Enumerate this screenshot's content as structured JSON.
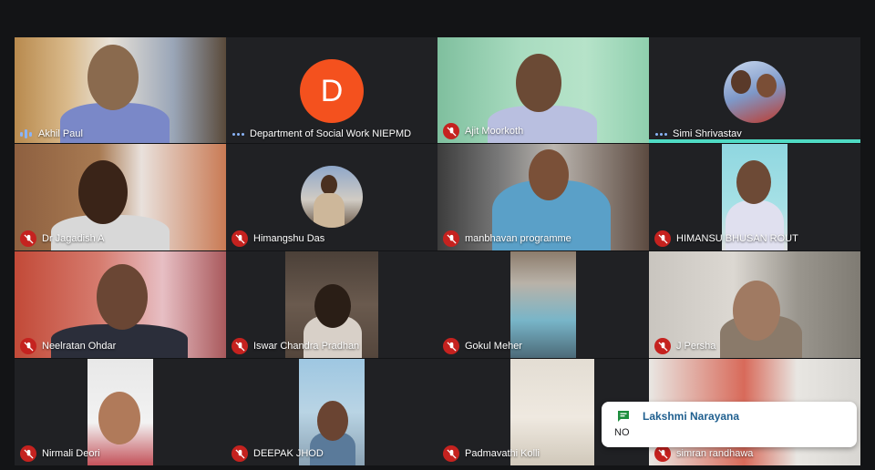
{
  "participants": [
    {
      "name": "Akhil Paul",
      "status": "speaking"
    },
    {
      "name": "Department of Social Work NIEPMD",
      "status": "no-video",
      "avatar_letter": "D",
      "avatar_color": "#f4511e"
    },
    {
      "name": "Ajit Moorkoth",
      "status": "muted"
    },
    {
      "name": "Simi Shrivastav",
      "status": "no-video-active"
    },
    {
      "name": "Dr Jagadish A",
      "status": "muted"
    },
    {
      "name": "Himangshu Das",
      "status": "muted"
    },
    {
      "name": "manbhavan programme",
      "status": "muted"
    },
    {
      "name": "HIMANSU BHUSAN ROUT",
      "status": "muted"
    },
    {
      "name": "Neelratan Ohdar",
      "status": "muted"
    },
    {
      "name": "Iswar Chandra Pradhan",
      "status": "muted"
    },
    {
      "name": "Gokul Meher",
      "status": "muted"
    },
    {
      "name": "J Persha",
      "status": "muted"
    },
    {
      "name": "Nirmali Deori",
      "status": "muted"
    },
    {
      "name": "DEEPAK JHOD",
      "status": "muted"
    },
    {
      "name": "Padmavathi Kolli",
      "status": "muted"
    },
    {
      "name": "simran randhawa",
      "status": "muted"
    }
  ],
  "chat_notification": {
    "sender": "Lakshmi Narayana",
    "message": "NO"
  },
  "colors": {
    "muted": "#c5221f",
    "active_speaker": "#4fdbc4",
    "speaking_indicator": "#8ab4f8",
    "background": "#131416"
  }
}
